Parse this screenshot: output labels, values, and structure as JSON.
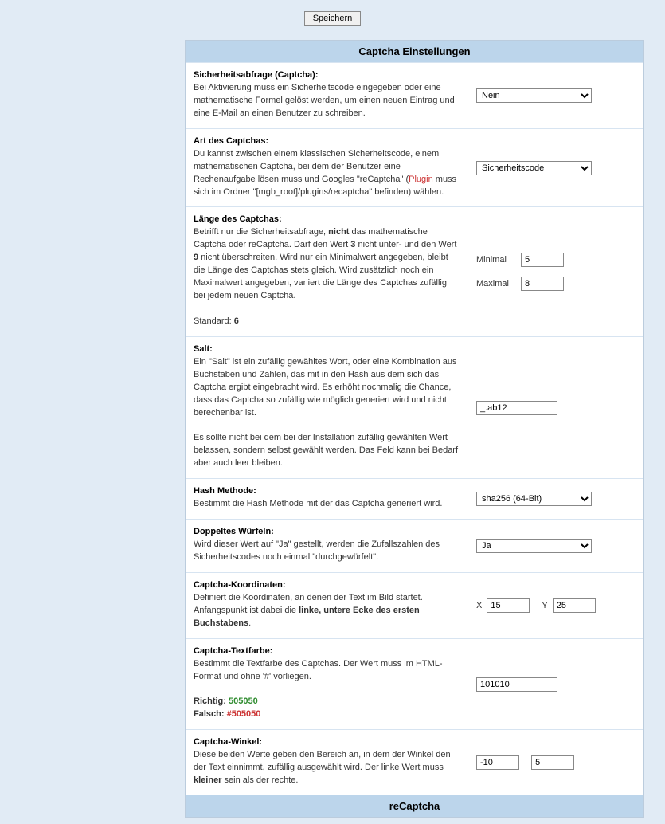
{
  "save_button": "Speichern",
  "section_title": "Captcha Einstellungen",
  "section_title2": "reCaptcha",
  "rows": {
    "activate": {
      "title": "Sicherheitsabfrage (Captcha):",
      "body": "Bei Aktivierung muss ein Sicherheitscode eingegeben oder eine mathematische Formel gelöst werden, um einen neuen Eintrag und eine E-Mail an einen Benutzer zu schreiben.",
      "value": "Nein"
    },
    "type": {
      "title": "Art des Captchas:",
      "body_pre": "Du kannst zwischen einem klassischen Sicherheitscode, einem mathematischen Captcha, bei dem der Benutzer eine Rechenaufgabe lösen muss und Googles \"reCaptcha\" (",
      "plugin_word": "Plugin",
      "body_post": " muss sich im Ordner \"[mgb_root]/plugins/recaptcha\" befinden) wählen.",
      "value": "Sicherheitscode"
    },
    "length": {
      "title": "Länge des Captchas:",
      "body_1": "Betrifft nur die Sicherheitsabfrage, ",
      "nicht": "nicht",
      "body_2": " das mathematische Captcha oder reCaptcha. Darf den Wert ",
      "v3": "3",
      "body_3": " nicht unter- und den Wert ",
      "v9": "9",
      "body_4": " nicht überschreiten. Wird nur ein Minimalwert angegeben, bleibt die Länge des Captchas stets gleich. Wird zusätzlich noch ein Maximalwert angegeben, variiert die Länge des Captchas zufällig bei jedem neuen Captcha.",
      "std_label": "Standard: ",
      "std_value": "6",
      "min_label": "Minimal",
      "min_value": "5",
      "max_label": "Maximal",
      "max_value": "8"
    },
    "salt": {
      "title": "Salt:",
      "body1": "Ein \"Salt\" ist ein zufällig gewähltes Wort, oder eine Kombination aus Buchstaben und Zahlen, das mit in den Hash aus dem sich das Captcha ergibt eingebracht wird. Es erhöht nochmalig die Chance, dass das Captcha so zufällig wie möglich generiert wird und nicht berechenbar ist.",
      "body2": "Es sollte nicht bei dem bei der Installation zufällig gewählten Wert belassen, sondern selbst gewählt werden. Das Feld kann bei Bedarf aber auch leer bleiben.",
      "value": "_.ab12"
    },
    "hash": {
      "title": "Hash Methode:",
      "body": "Bestimmt die Hash Methode mit der das Captcha generiert wird.",
      "value": "sha256 (64-Bit)"
    },
    "double": {
      "title": "Doppeltes Würfeln:",
      "body": "Wird dieser Wert auf \"Ja\" gestellt, werden die Zufallszahlen des Sicherheitscodes noch einmal \"durchgewürfelt\".",
      "value": "Ja"
    },
    "coords": {
      "title": "Captcha-Koordinaten:",
      "body_pre": "Definiert die Koordinaten, an denen der Text im Bild startet. Anfangspunkt ist dabei die ",
      "bold": "linke, untere Ecke des ersten Buchstabens",
      "body_post": ".",
      "x_label": "X",
      "x_value": "15",
      "y_label": "Y",
      "y_value": "25"
    },
    "textcolor": {
      "title": "Captcha-Textfarbe:",
      "body": "Bestimmt die Textfarbe des Captchas. Der Wert muss im HTML-Format und ohne '#' vorliegen.",
      "right_label": "Richtig: ",
      "right_val": "505050",
      "wrong_label": "Falsch: ",
      "wrong_val": "#505050",
      "value": "101010"
    },
    "angle": {
      "title": "Captcha-Winkel:",
      "body_pre": "Diese beiden Werte geben den Bereich an, in dem der Winkel den der Text einnimmt, zufällig ausgewählt wird. Der linke Wert muss ",
      "bold": "kleiner",
      "body_post": " sein als der rechte.",
      "v1": "-10",
      "v2": "5"
    }
  }
}
